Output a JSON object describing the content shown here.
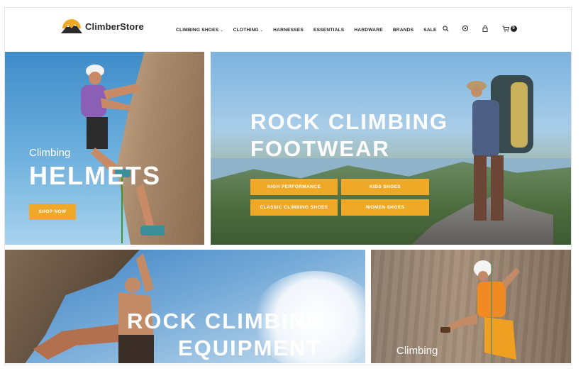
{
  "brand": {
    "name": "ClimberStore"
  },
  "nav": {
    "items": [
      {
        "label": "CLIMBING SHOES",
        "dropdown": true
      },
      {
        "label": "CLOTHING",
        "dropdown": true
      },
      {
        "label": "HARNESSES",
        "dropdown": false
      },
      {
        "label": "ESSENTIALS",
        "dropdown": false
      },
      {
        "label": "HARDWARE",
        "dropdown": false
      },
      {
        "label": "BRANDS",
        "dropdown": false
      },
      {
        "label": "SALE",
        "dropdown": false
      }
    ]
  },
  "header_icons": {
    "search": "search-icon",
    "settings": "gear-icon",
    "account": "lock-icon",
    "cart": "cart-icon",
    "cart_count": "0"
  },
  "banners": {
    "helmets": {
      "small": "Climbing",
      "title": "HELMETS",
      "button": "SHOP NOW"
    },
    "footwear": {
      "title_line1": "ROCK CLIMBING",
      "title_line2": "FOOTWEAR",
      "buttons": [
        "HIGH PERFORMANCE",
        "KIDS SHOES",
        "CLASSIC CLIMBING SHOES",
        "WOMEN SHOES"
      ]
    },
    "equipment": {
      "title_line1": "ROCK CLIMBING",
      "title_line2": "EQUIPMENT"
    },
    "climbing": {
      "small": "Climbing"
    }
  },
  "colors": {
    "accent": "#f0a927",
    "text_dark": "#222222"
  }
}
